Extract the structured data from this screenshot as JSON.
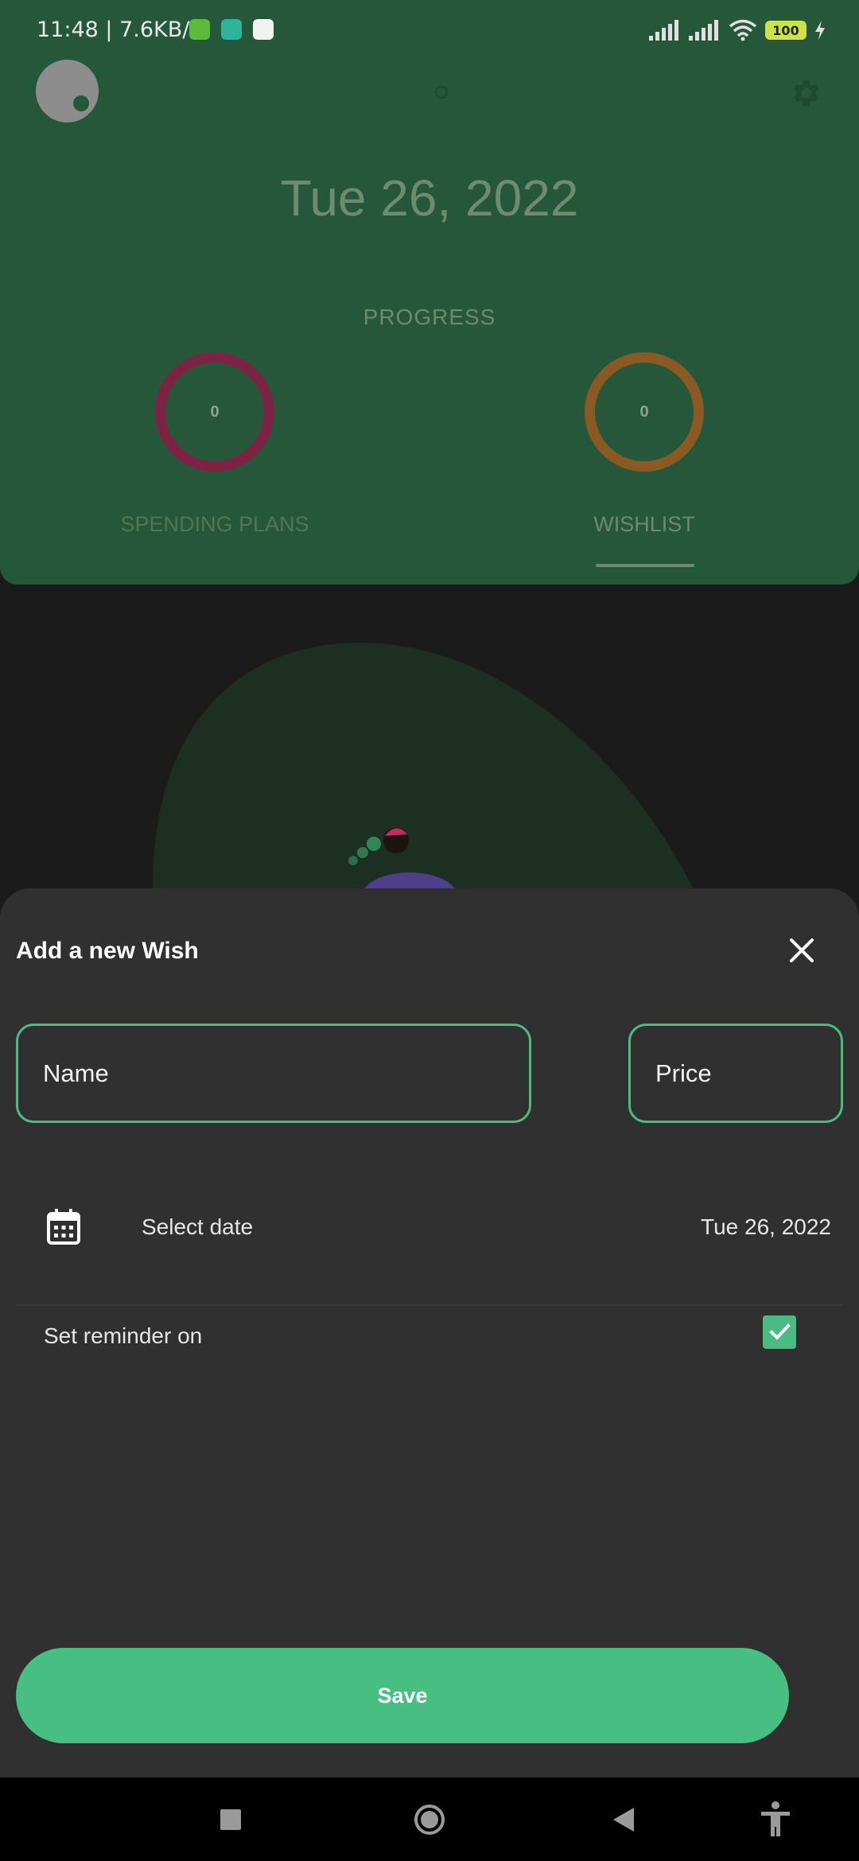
{
  "status_bar": {
    "time": "11:48 | 7.6KB/s",
    "battery": "100"
  },
  "header": {
    "date": "Tue 26, 2022",
    "progress_label": "PROGRESS",
    "spending": {
      "label": "SPENDING PLANS",
      "value": "0"
    },
    "wishlist": {
      "label": "WISHLIST",
      "value": "0"
    }
  },
  "sheet": {
    "title": "Add a new Wish",
    "name_placeholder": "Name",
    "price_placeholder": "Price",
    "select_date_label": "Select date",
    "date_value": "Tue 26, 2022",
    "reminder_label": "Set reminder on",
    "reminder_checked": true,
    "save_label": "Save"
  },
  "colors": {
    "accent": "#47bf82",
    "header_bg": "#25583b",
    "sheet_bg": "#303030",
    "spending_ring": "#7d2242",
    "wishlist_ring": "#8a5a22"
  }
}
